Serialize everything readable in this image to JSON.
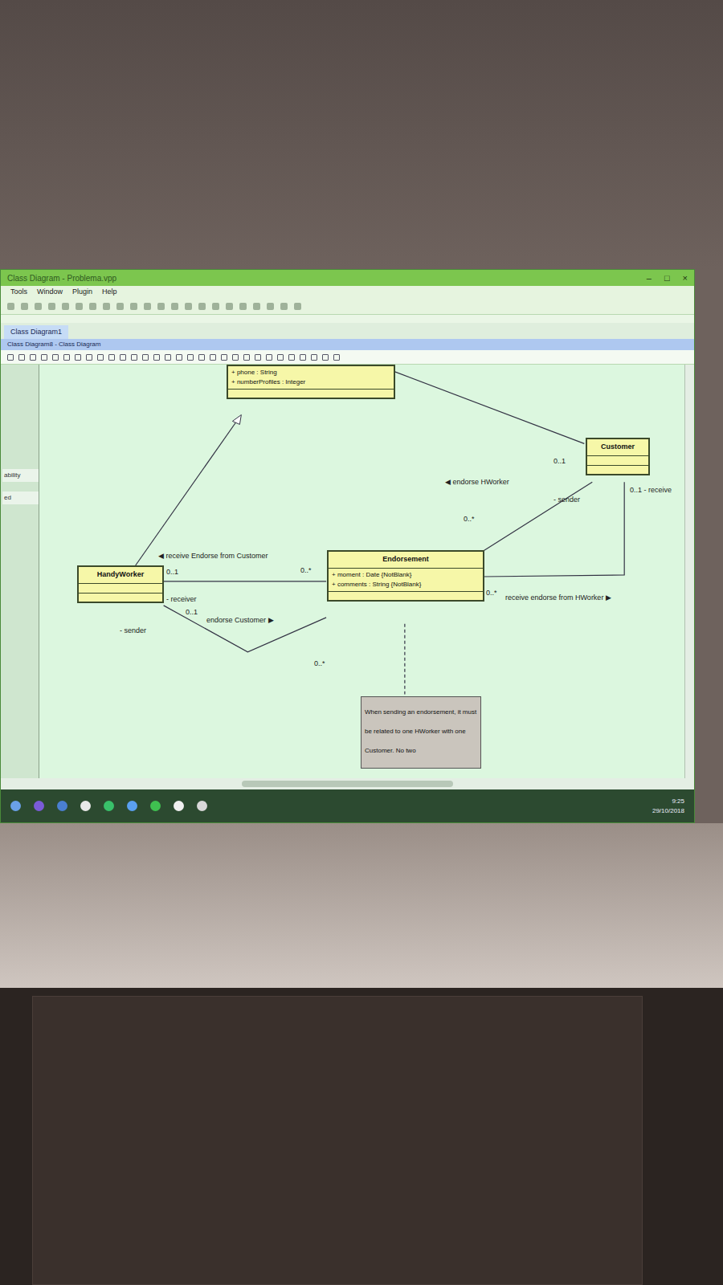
{
  "window": {
    "title": "Class Diagram - Problema.vpp",
    "controls": [
      "–",
      "□",
      "×"
    ],
    "menu": [
      "Tools",
      "Window",
      "Plugin",
      "Help"
    ]
  },
  "tabs": [
    {
      "label": "Class Diagram1",
      "selected": true
    }
  ],
  "diagram_tab": "Class Diagram8 - Class Diagram",
  "sidebar": [
    "ability",
    "ed"
  ],
  "classes": [
    {
      "attributes": [
        "+ phone : String",
        "+ numberProfiles : Integer"
      ]
    },
    {
      "name": "Customer",
      "attributes": []
    },
    {
      "name": "HandyWorker",
      "attributes": []
    },
    {
      "name": "Endorsement",
      "attributes": [
        "+ moment : Date {NotBlank}",
        "+ comments : String {NotBlank}"
      ]
    }
  ],
  "labels": [
    "0..1",
    "◀ endorse HWorker",
    "- sender",
    "0..1 - receive",
    "0..*",
    "◀ receive Endorse from Customer",
    "0..1",
    "0..*",
    "- receiver",
    "0..1",
    "endorse Customer ▶",
    "- sender",
    "0..*",
    "0..*",
    "receive endorse from HWorker ▶"
  ],
  "note": "When sending an endorsement, it must be related to one HWorker with one Customer. No two",
  "taskbar": {
    "time": "9:25",
    "date": "29/10/2018"
  }
}
